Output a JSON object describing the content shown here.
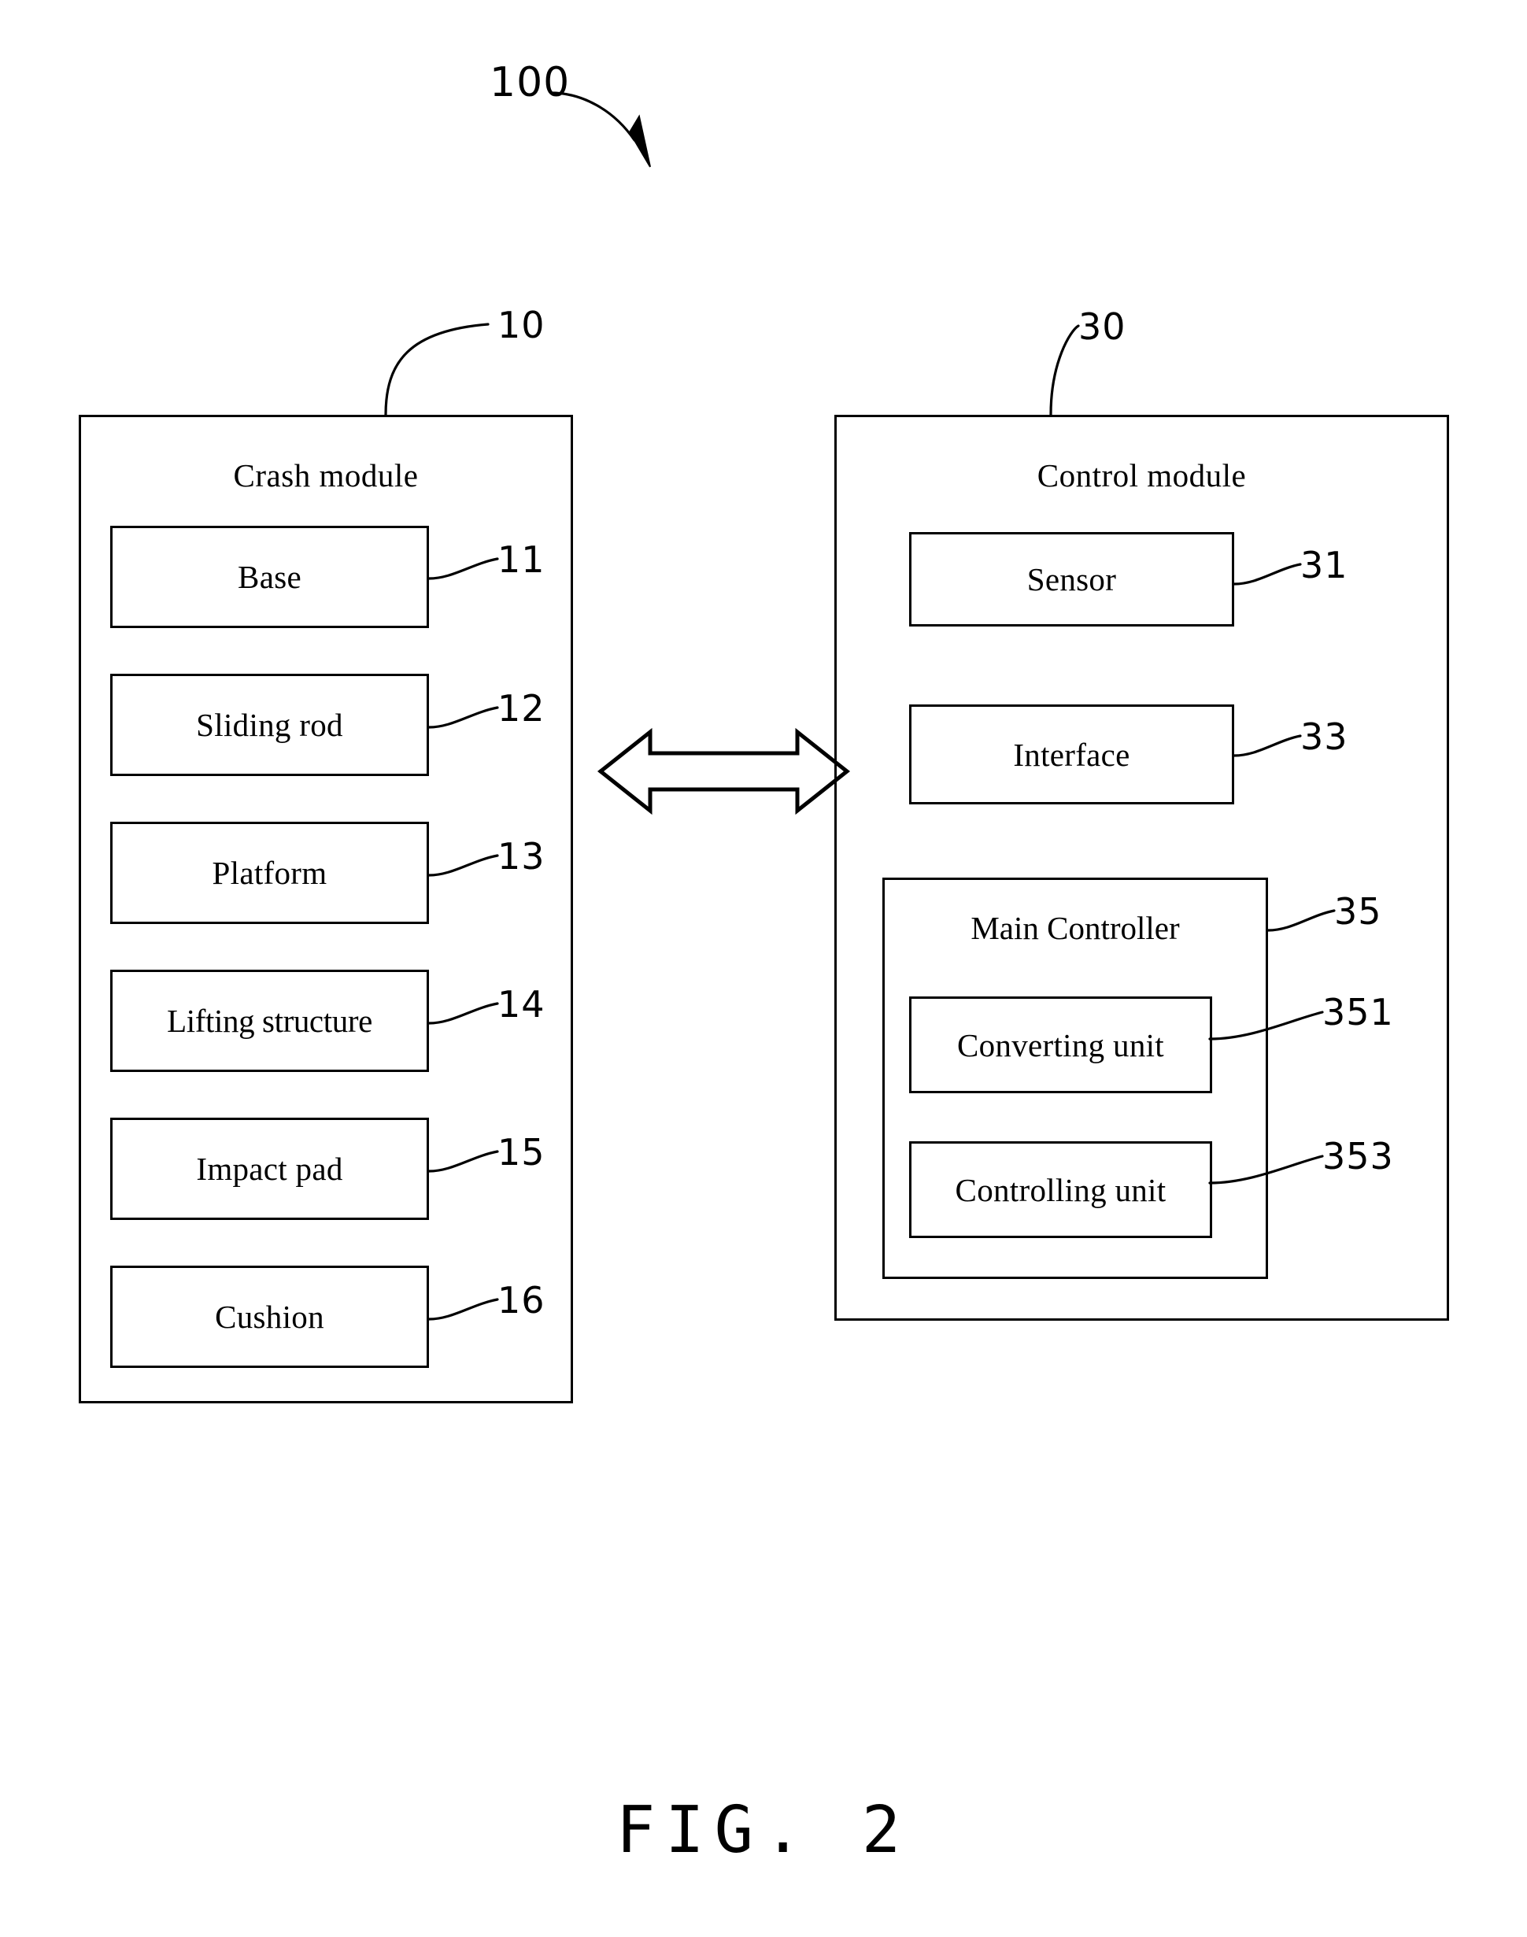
{
  "figure": {
    "caption": "FIG. 2",
    "system_ref": "100"
  },
  "modules": [
    {
      "id": "crash-module",
      "title": "Crash module",
      "ref": "10",
      "components": [
        {
          "label": "Base",
          "ref": "11"
        },
        {
          "label": "Sliding rod",
          "ref": "12"
        },
        {
          "label": "Platform",
          "ref": "13"
        },
        {
          "label": "Lifting structure",
          "ref": "14"
        },
        {
          "label": "Impact pad",
          "ref": "15"
        },
        {
          "label": "Cushion",
          "ref": "16"
        }
      ]
    },
    {
      "id": "control-module",
      "title": "Control module",
      "ref": "30",
      "components": [
        {
          "label": "Sensor",
          "ref": "31"
        },
        {
          "label": "Interface",
          "ref": "33"
        }
      ],
      "main_controller": {
        "label": "Main Controller",
        "ref": "35",
        "units": [
          {
            "label": "Converting unit",
            "ref": "351"
          },
          {
            "label": "Controlling unit",
            "ref": "353"
          }
        ]
      }
    }
  ],
  "connector": {
    "name": "bidirectional-arrow",
    "description": "double headed arrow linking crash module and control module"
  },
  "colors": {
    "ink": "#000000",
    "background": "#ffffff"
  }
}
